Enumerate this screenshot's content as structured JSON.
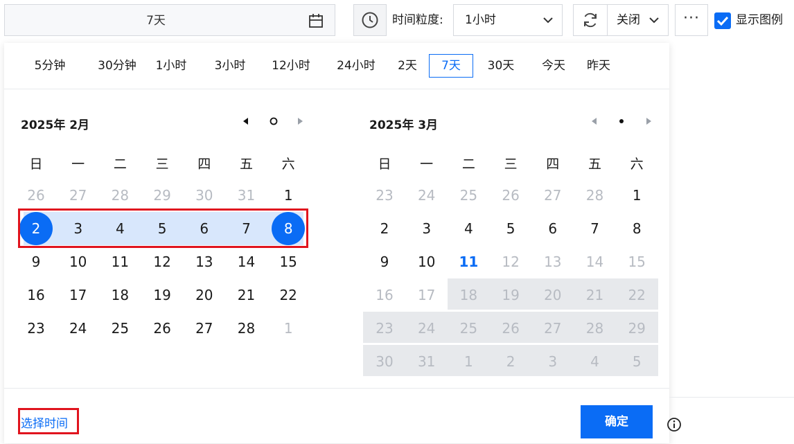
{
  "toolbar": {
    "range_value": "7天",
    "granularity_label": "时间粒度:",
    "granularity_value": "1小时",
    "refresh_interval": "关闭",
    "more": "···",
    "show_legend_label": "显示图例",
    "show_legend_checked": true
  },
  "quick_options": [
    "5分钟",
    "30分钟",
    "1小时",
    "3小时",
    "12小时",
    "24小时",
    "2天",
    "7天",
    "30天",
    "今天",
    "昨天"
  ],
  "quick_selected": "7天",
  "weekdays": [
    "日",
    "一",
    "二",
    "三",
    "四",
    "五",
    "六"
  ],
  "left_calendar": {
    "title": "2025年 2月",
    "days": [
      "26",
      "27",
      "28",
      "29",
      "30",
      "31",
      "1",
      "2",
      "3",
      "4",
      "5",
      "6",
      "7",
      "8",
      "9",
      "10",
      "11",
      "12",
      "13",
      "14",
      "15",
      "16",
      "17",
      "18",
      "19",
      "20",
      "21",
      "22",
      "23",
      "24",
      "25",
      "26",
      "27",
      "28",
      "1"
    ]
  },
  "right_calendar": {
    "title": "2025年 3月",
    "days": [
      "23",
      "24",
      "25",
      "26",
      "27",
      "28",
      "1",
      "2",
      "3",
      "4",
      "5",
      "6",
      "7",
      "8",
      "9",
      "10",
      "11",
      "12",
      "13",
      "14",
      "15",
      "16",
      "17",
      "18",
      "19",
      "20",
      "21",
      "22",
      "23",
      "24",
      "25",
      "26",
      "27",
      "28",
      "29",
      "30",
      "31",
      "1",
      "2",
      "3",
      "4",
      "5"
    ]
  },
  "footer": {
    "pick_time": "选择时间",
    "confirm": "确定"
  },
  "colors": {
    "accent": "#0a6cf5",
    "range_band": "#d8e7fc",
    "disabled": "#e7e9ec",
    "highlight_box": "#e0141e"
  }
}
